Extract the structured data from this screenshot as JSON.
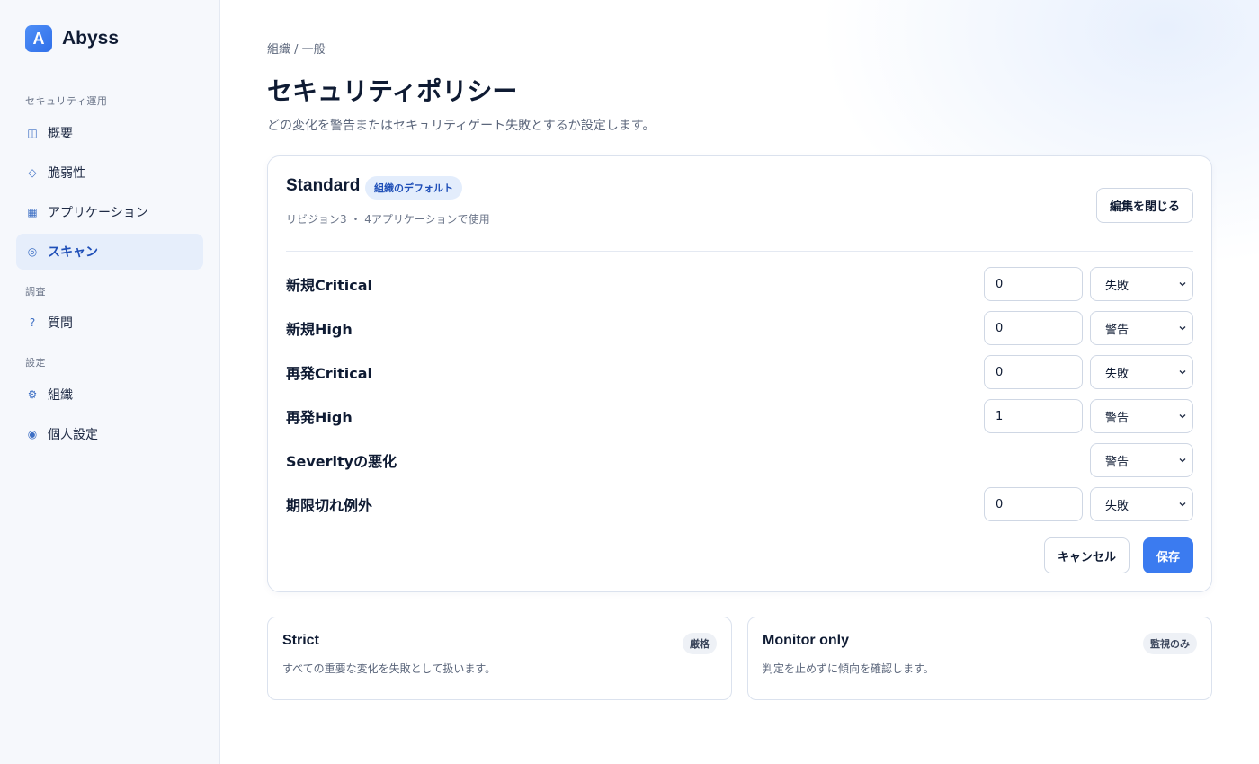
{
  "brand": {
    "logo_letter": "A",
    "name": "Abyss"
  },
  "sidebar": {
    "sections": [
      {
        "label": "セキュリティ運用"
      },
      {
        "label": "調査"
      },
      {
        "label": "設定"
      }
    ],
    "items": [
      {
        "label": "概要",
        "icon": "overview-icon",
        "glyph": "◫"
      },
      {
        "label": "脆弱性",
        "icon": "diamond-icon",
        "glyph": "◇"
      },
      {
        "label": "アプリケーション",
        "icon": "grid-icon",
        "glyph": "▦"
      },
      {
        "label": "スキャン",
        "icon": "scan-icon",
        "glyph": "◎",
        "active": true
      },
      {
        "label": "質問",
        "icon": "question-icon",
        "glyph": "?"
      },
      {
        "label": "組織",
        "icon": "gear-icon",
        "glyph": "⚙"
      },
      {
        "label": "個人設定",
        "icon": "user-icon",
        "glyph": "◉"
      }
    ]
  },
  "header": {
    "breadcrumb": "組織 / 一般",
    "title": "セキュリティポリシー",
    "description": "どの変化を警告またはセキュリティゲート失敗とするか設定します。"
  },
  "policy": {
    "name": "Standard",
    "badge": "組織のデフォルト",
    "meta": "リビジョン3 ・ 4アプリケーションで使用",
    "close_edit_label": "編集を閉じる",
    "rules": [
      {
        "label": "新規Critical",
        "threshold": "0",
        "action": "失敗"
      },
      {
        "label": "新規High",
        "threshold": "0",
        "action": "警告"
      },
      {
        "label": "再発Critical",
        "threshold": "0",
        "action": "失敗"
      },
      {
        "label": "再発High",
        "threshold": "1",
        "action": "警告"
      },
      {
        "label": "Severityの悪化",
        "threshold": null,
        "action": "警告"
      },
      {
        "label": "期限切れ例外",
        "threshold": "0",
        "action": "失敗"
      }
    ],
    "cancel_label": "キャンセル",
    "save_label": "保存"
  },
  "presets": [
    {
      "title": "Strict",
      "badge": "厳格",
      "description": "すべての重要な変化を失敗として扱います。"
    },
    {
      "title": "Monitor only",
      "badge": "監視のみ",
      "description": "判定を止めずに傾向を確認します。"
    }
  ],
  "colors": {
    "accent": "#3b7bf0",
    "active_nav_bg": "#e6eefb",
    "badge_bg": "#e3edfc"
  }
}
